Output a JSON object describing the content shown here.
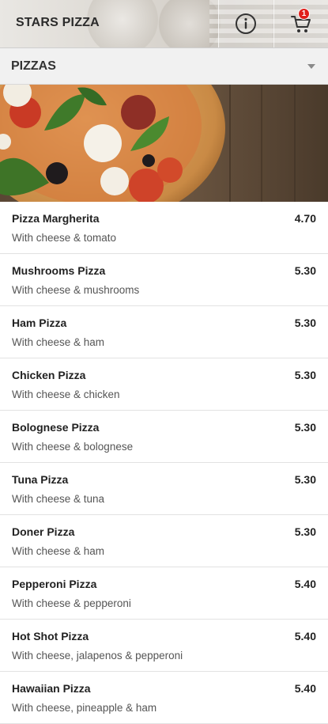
{
  "header": {
    "title": "STARS PIZZA",
    "info_icon": "info-circle-icon",
    "cart_icon": "shopping-cart-icon",
    "cart_count": "1"
  },
  "category": {
    "label": "PIZZAS",
    "icon": "chevron-down-icon"
  },
  "menu": {
    "items": [
      {
        "name": "Pizza Margherita",
        "description": "With cheese & tomato",
        "price": "4.70"
      },
      {
        "name": "Mushrooms Pizza",
        "description": "With cheese & mushrooms",
        "price": "5.30"
      },
      {
        "name": "Ham Pizza",
        "description": "With cheese & ham",
        "price": "5.30"
      },
      {
        "name": "Chicken Pizza",
        "description": "With cheese & chicken",
        "price": "5.30"
      },
      {
        "name": "Bolognese Pizza",
        "description": "With cheese & bolognese",
        "price": "5.30"
      },
      {
        "name": "Tuna Pizza",
        "description": "With cheese & tuna",
        "price": "5.30"
      },
      {
        "name": "Doner Pizza",
        "description": "With cheese & ham",
        "price": "5.30"
      },
      {
        "name": "Pepperoni Pizza",
        "description": "With cheese & pepperoni",
        "price": "5.40"
      },
      {
        "name": "Hot Shot Pizza",
        "description": "With cheese, jalapenos & pepperoni",
        "price": "5.40"
      },
      {
        "name": "Hawaiian Pizza",
        "description": "With cheese, pineapple & ham",
        "price": "5.40"
      }
    ]
  },
  "colors": {
    "badge": "#e0201c",
    "category_bar": "#f1f1f1"
  }
}
